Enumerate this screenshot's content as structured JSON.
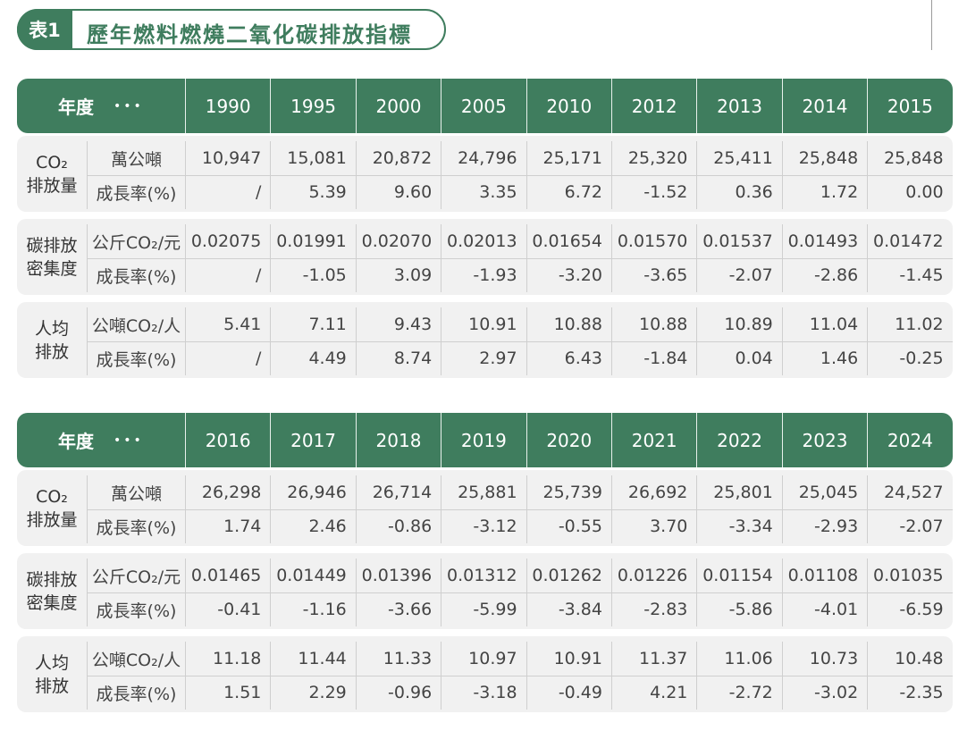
{
  "title": {
    "badge": "表1",
    "text": "歷年燃料燃燒二氧化碳排放指標"
  },
  "header_label": "年度",
  "header_dots": "•••",
  "metrics": [
    {
      "label_lines": [
        "CO₂",
        "排放量"
      ],
      "units": [
        "萬公噸",
        "成長率(%)"
      ]
    },
    {
      "label_lines": [
        "碳排放",
        "密集度"
      ],
      "units": [
        "公斤CO₂/元",
        "成長率(%)"
      ]
    },
    {
      "label_lines": [
        "人均",
        "排放"
      ],
      "units": [
        "公噸CO₂/人",
        "成長率(%)"
      ]
    }
  ],
  "tables": [
    {
      "years": [
        "1990",
        "1995",
        "2000",
        "2005",
        "2010",
        "2012",
        "2013",
        "2014",
        "2015"
      ],
      "groups": [
        [
          [
            "10,947",
            "15,081",
            "20,872",
            "24,796",
            "25,171",
            "25,320",
            "25,411",
            "25,848",
            "25,848"
          ],
          [
            "/",
            "5.39",
            "9.60",
            "3.35",
            "6.72",
            "-1.52",
            "0.36",
            "1.72",
            "0.00"
          ]
        ],
        [
          [
            "0.02075",
            "0.01991",
            "0.02070",
            "0.02013",
            "0.01654",
            "0.01570",
            "0.01537",
            "0.01493",
            "0.01472"
          ],
          [
            "/",
            "-1.05",
            "3.09",
            "-1.93",
            "-3.20",
            "-3.65",
            "-2.07",
            "-2.86",
            "-1.45"
          ]
        ],
        [
          [
            "5.41",
            "7.11",
            "9.43",
            "10.91",
            "10.88",
            "10.88",
            "10.89",
            "11.04",
            "11.02"
          ],
          [
            "/",
            "4.49",
            "8.74",
            "2.97",
            "6.43",
            "-1.84",
            "0.04",
            "1.46",
            "-0.25"
          ]
        ]
      ]
    },
    {
      "years": [
        "2016",
        "2017",
        "2018",
        "2019",
        "2020",
        "2021",
        "2022",
        "2023",
        "2024"
      ],
      "groups": [
        [
          [
            "26,298",
            "26,946",
            "26,714",
            "25,881",
            "25,739",
            "26,692",
            "25,801",
            "25,045",
            "24,527"
          ],
          [
            "1.74",
            "2.46",
            "-0.86",
            "-3.12",
            "-0.55",
            "3.70",
            "-3.34",
            "-2.93",
            "-2.07"
          ]
        ],
        [
          [
            "0.01465",
            "0.01449",
            "0.01396",
            "0.01312",
            "0.01262",
            "0.01226",
            "0.01154",
            "0.01108",
            "0.01035"
          ],
          [
            "-0.41",
            "-1.16",
            "-3.66",
            "-5.99",
            "-3.84",
            "-2.83",
            "-5.86",
            "-4.01",
            "-6.59"
          ]
        ],
        [
          [
            "11.18",
            "11.44",
            "11.33",
            "10.97",
            "10.91",
            "11.37",
            "11.06",
            "10.73",
            "10.48"
          ],
          [
            "1.51",
            "2.29",
            "-0.96",
            "-3.18",
            "-0.49",
            "4.21",
            "-2.72",
            "-3.02",
            "-2.35"
          ]
        ]
      ]
    }
  ]
}
